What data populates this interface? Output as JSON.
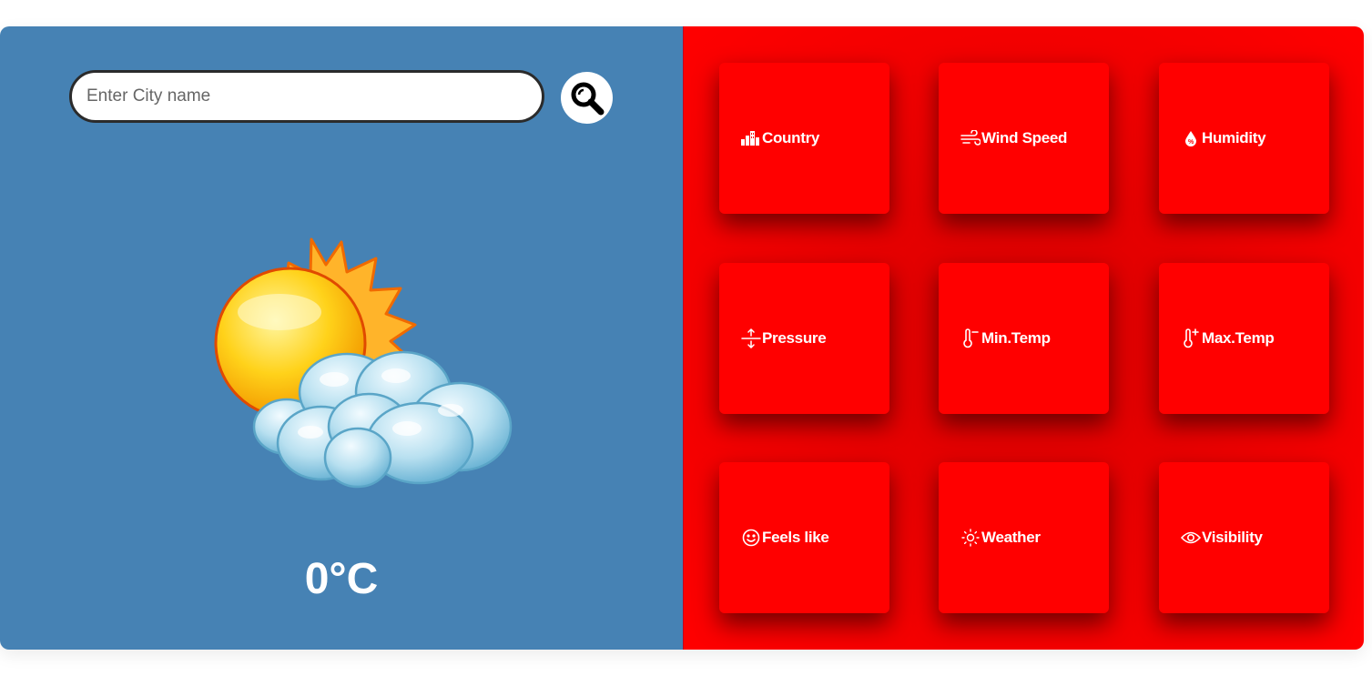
{
  "search": {
    "placeholder": "Enter City name",
    "value": ""
  },
  "temperature": "0°C",
  "tiles": [
    {
      "label": "Country",
      "icon": "city-icon"
    },
    {
      "label": "Wind Speed",
      "icon": "wind-icon"
    },
    {
      "label": "Humidity",
      "icon": "humidity-drop-icon"
    },
    {
      "label": "Pressure",
      "icon": "pressure-arrows-icon"
    },
    {
      "label": "Min.Temp",
      "icon": "thermometer-minus-icon"
    },
    {
      "label": "Max.Temp",
      "icon": "thermometer-plus-icon"
    },
    {
      "label": "Feels like",
      "icon": "smiley-icon"
    },
    {
      "label": "Weather",
      "icon": "sun-icon"
    },
    {
      "label": "Visibility",
      "icon": "eye-icon"
    }
  ],
  "colors": {
    "left_panel": "#4682b4",
    "right_panel": "#ff0000",
    "tile": "#ff0000"
  }
}
